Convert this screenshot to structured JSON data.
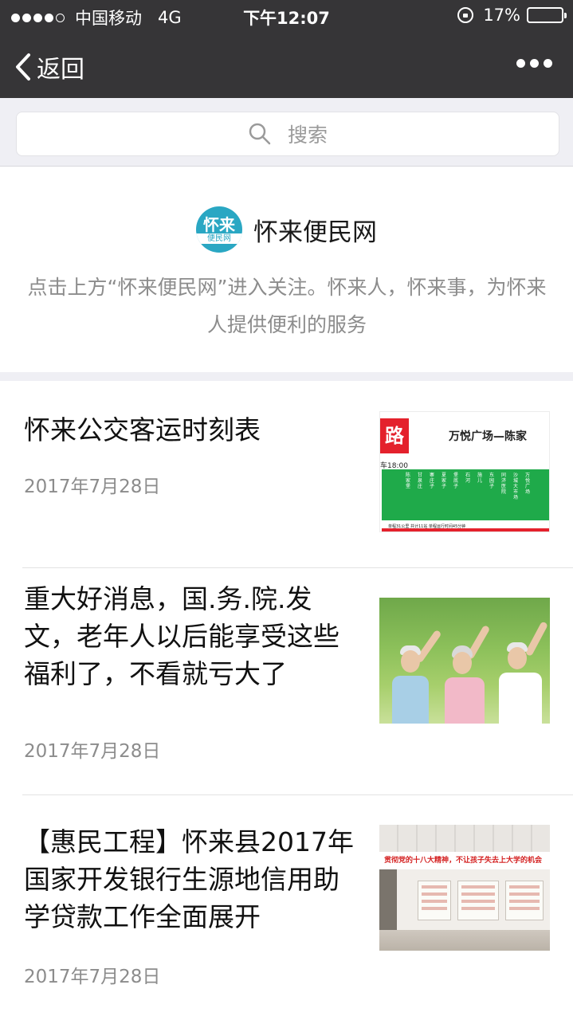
{
  "status_bar": {
    "carrier": "中国移动",
    "network": "4G",
    "time": "下午12:07",
    "battery_percent": "17%",
    "battery_level": 0.17,
    "signal_bars_filled": 4,
    "signal_bars_total": 5,
    "battery_color": "#e0201f"
  },
  "nav": {
    "back_label": "返回",
    "more_icon": "more-dots-icon"
  },
  "search": {
    "placeholder": "搜索",
    "icon": "search-icon"
  },
  "account": {
    "logo_text_top": "怀来",
    "logo_text_bottom": "便民网",
    "name": "怀来便民网",
    "description": "点击上方“怀来便民网”进入关注。怀来人，怀来事，为怀来人提供便利的服务",
    "brand_color": "#2aa7c3"
  },
  "articles": [
    {
      "title": "怀来公交客运时刻表",
      "date": "2017年7月28日",
      "thumb": {
        "road_char": "路",
        "route": "万悦广场—陈家",
        "depart": "车18:00",
        "stops": [
          "万悦广场",
          "沙城大市场",
          "同济医院",
          "东园子",
          "施儿",
          "石河",
          "堡底子",
          "夏家子",
          "寨庄子",
          "甘泉庄",
          "陈家堡"
        ],
        "footer": "单程31公里  共计11站  单程运行时间45分钟"
      }
    },
    {
      "title": "重大好消息，国.务.院.发文，老年人以后能享受这些福利了，不看就亏大了",
      "date": "2017年7月28日"
    },
    {
      "title": "【惠民工程】怀来县2017年国家开发银行生源地信用助学贷款工作全面展开",
      "date": "2017年7月28日",
      "thumb": {
        "banner": "贯彻党的十八大精神，不让孩子失去上大学的机会"
      }
    }
  ]
}
